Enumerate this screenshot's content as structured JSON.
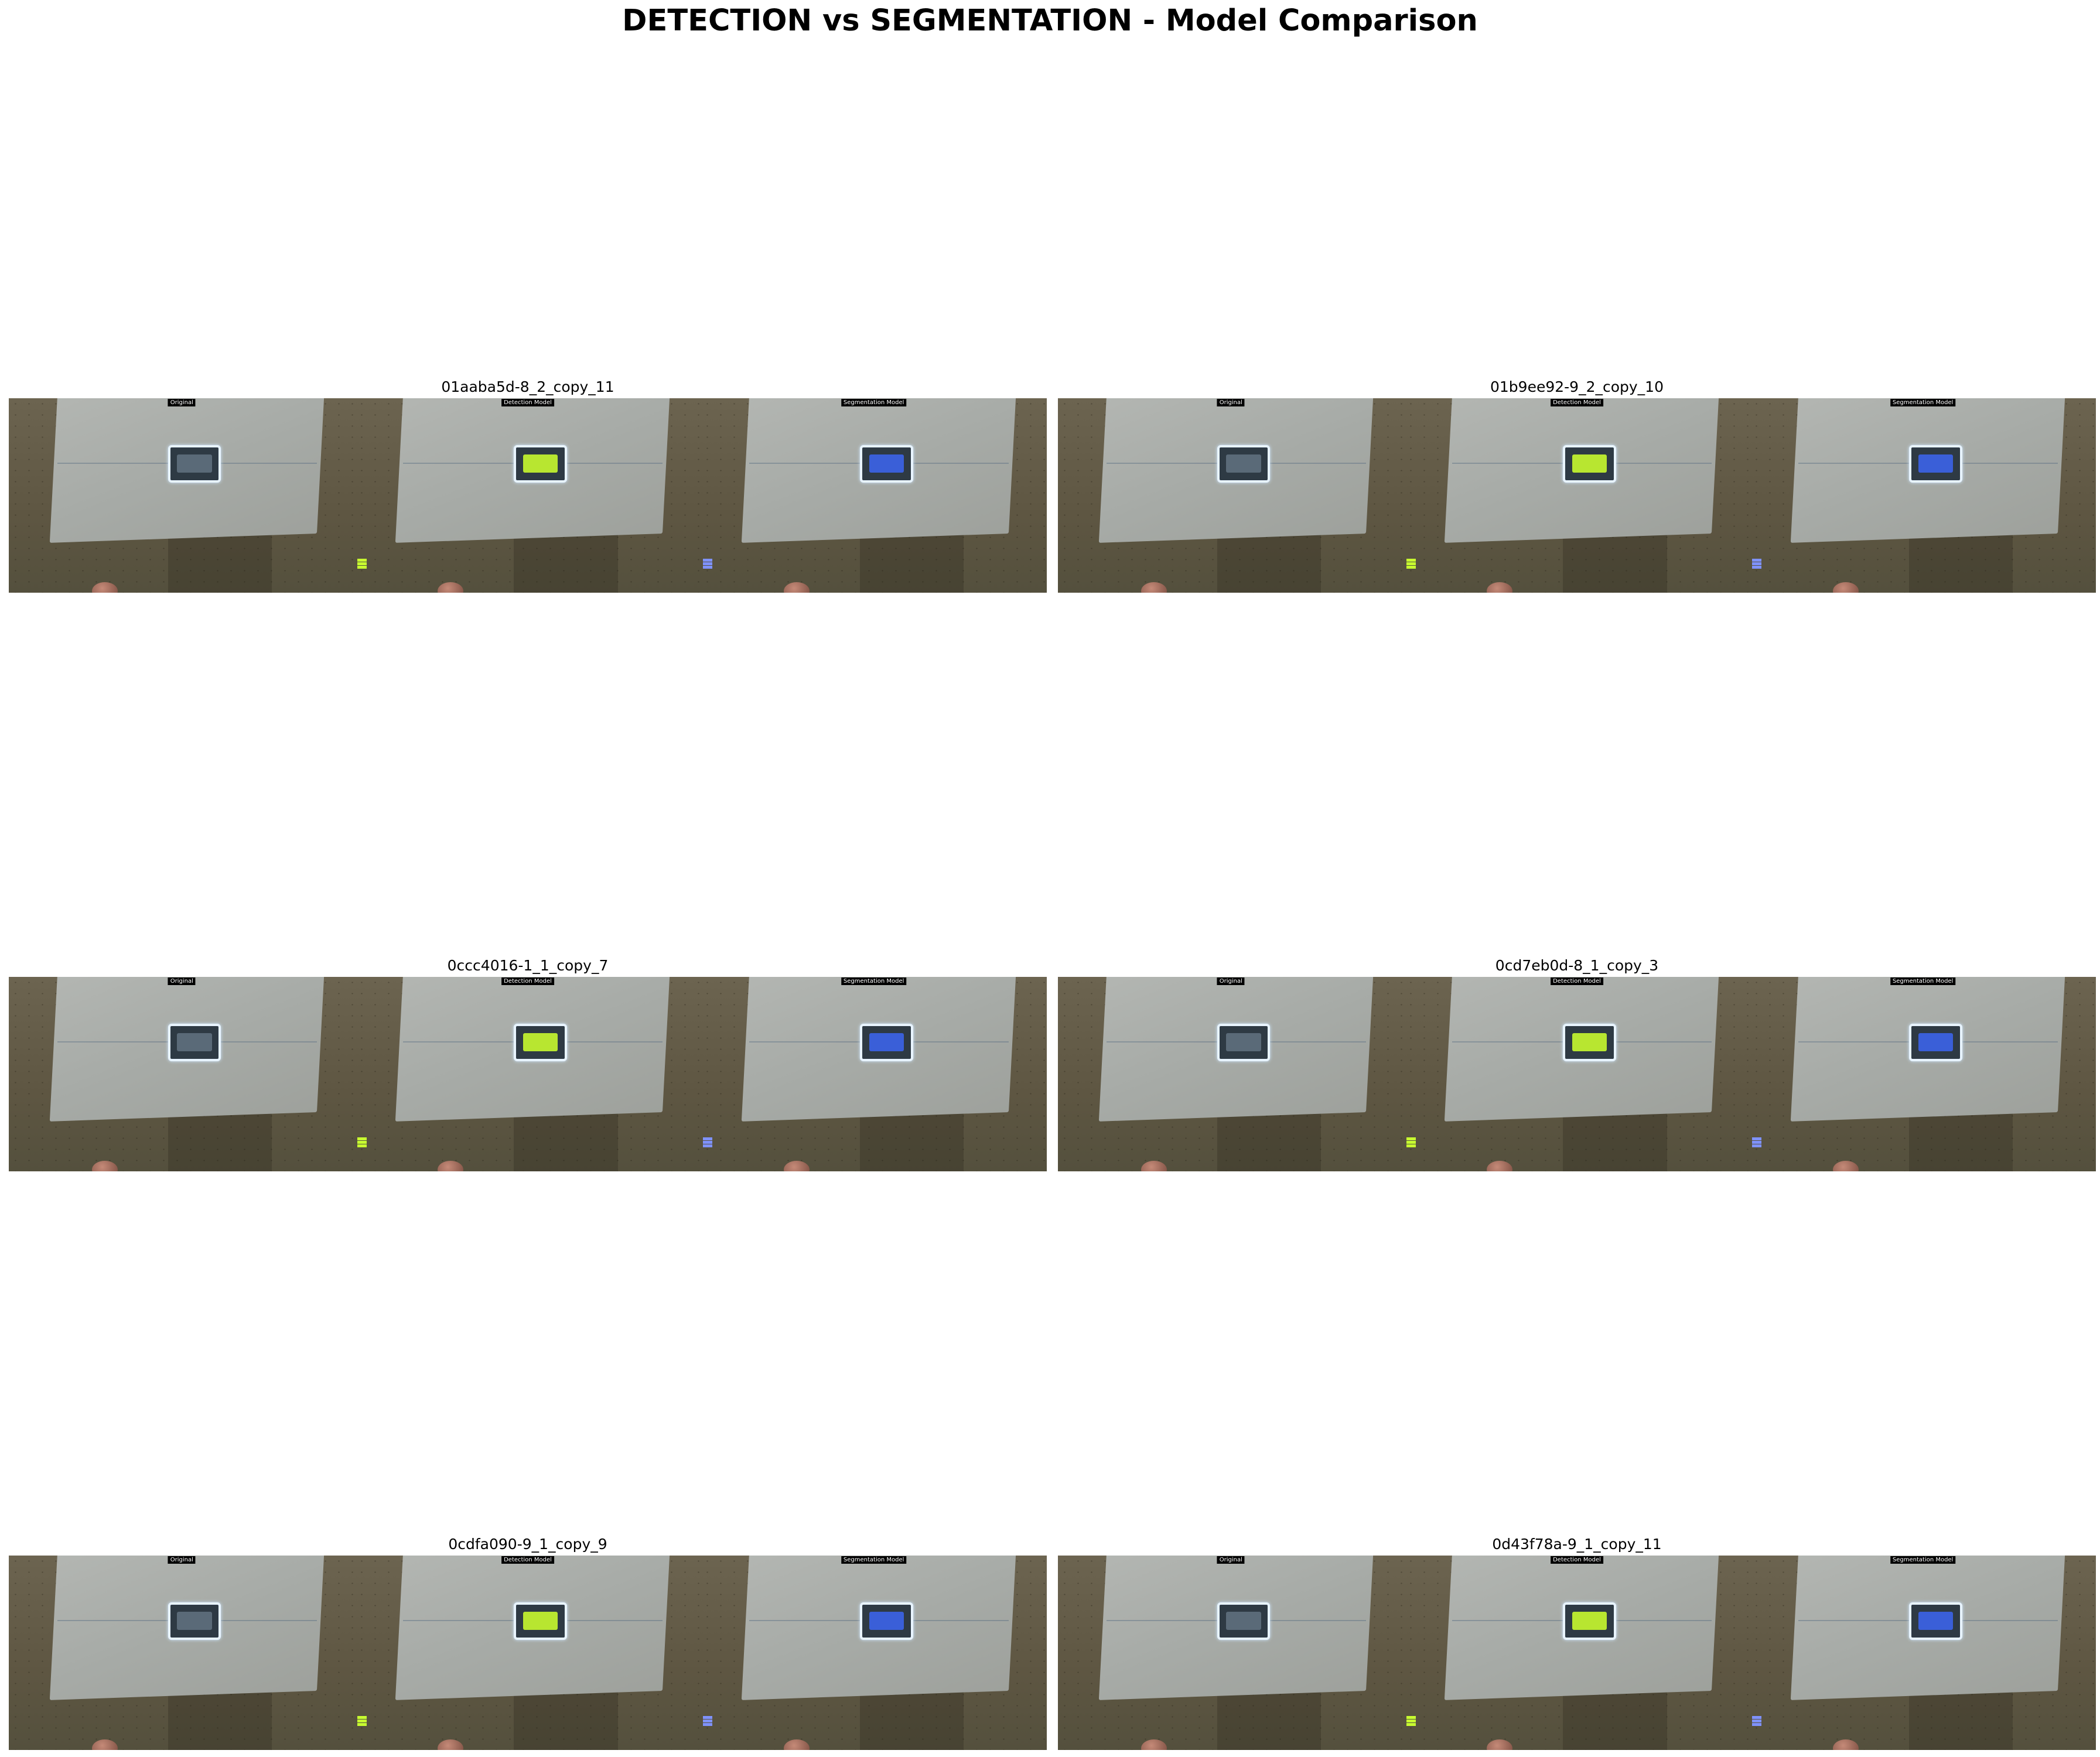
{
  "figure_title": "DETECTION vs SEGMENTATION - Model Comparison",
  "sub_labels": {
    "original": "Original",
    "detection": "Detection Model",
    "segmentation": "Segmentation Model"
  },
  "panels": [
    {
      "title": "01aaba5d-8_2_copy_11"
    },
    {
      "title": "01b9ee92-9_2_copy_10"
    },
    {
      "title": "0ccc4016-1_1_copy_7"
    },
    {
      "title": "0cd7eb0d-8_1_copy_3"
    },
    {
      "title": "0cdfa090-9_1_copy_9"
    },
    {
      "title": "0d43f78a-9_1_copy_11"
    }
  ]
}
